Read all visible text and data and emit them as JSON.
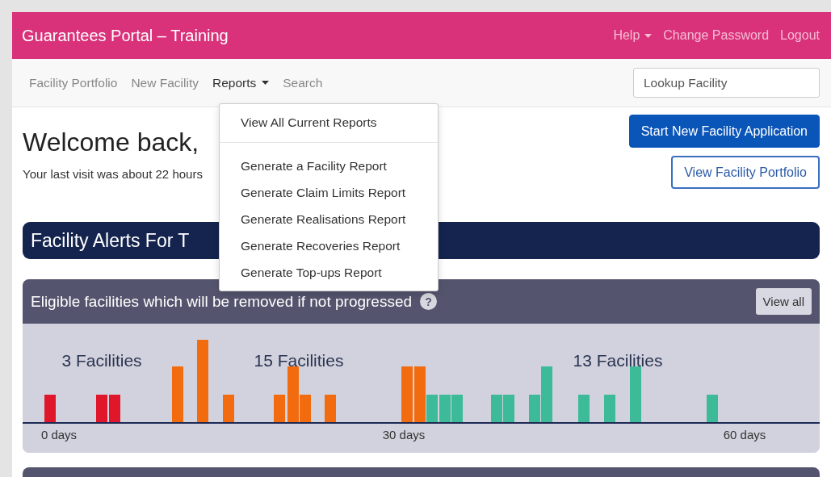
{
  "header": {
    "title": "Guarantees Portal – Training",
    "links": [
      {
        "label": "Help",
        "dropdown": true
      },
      {
        "label": "Change Password",
        "dropdown": false
      },
      {
        "label": "Logout",
        "dropdown": false
      }
    ]
  },
  "nav": {
    "items": [
      {
        "label": "Facility Portfolio",
        "selected": false,
        "dropdown": false
      },
      {
        "label": "New Facility",
        "selected": false,
        "dropdown": false
      },
      {
        "label": "Reports",
        "selected": true,
        "dropdown": true
      },
      {
        "label": "Search",
        "selected": false,
        "dropdown": false
      }
    ],
    "lookup": {
      "placeholder": "Lookup Facility"
    }
  },
  "reports_menu": {
    "sections": [
      [
        "View All Current Reports"
      ],
      [
        "Generate a Facility Report",
        "Generate Claim Limits Report",
        "Generate Realisations Report",
        "Generate Recoveries Report",
        "Generate Top-ups Report"
      ]
    ]
  },
  "welcome": {
    "heading": "Welcome back,",
    "last_visit": "Your last visit was about 22 hours"
  },
  "buttons": [
    {
      "label": "Start New Facility Application",
      "kind": "primary"
    },
    {
      "label": "View Facility Portfolio",
      "kind": "outline"
    }
  ],
  "alerts_title": "Facility Alerts For T",
  "eligible_panel": {
    "title": "Eligible facilities which will be removed if not progressed",
    "help_icon": "?",
    "view_all": "View all",
    "groups": [
      {
        "label": "3 Facilities",
        "color": "#e0162b"
      },
      {
        "label": "15 Facilities",
        "color": "#f26b0f"
      },
      {
        "label": "13 Facilities",
        "color": "#3dba98"
      }
    ],
    "axis_labels": [
      "0 days",
      "30 days",
      "60 days"
    ]
  }
}
